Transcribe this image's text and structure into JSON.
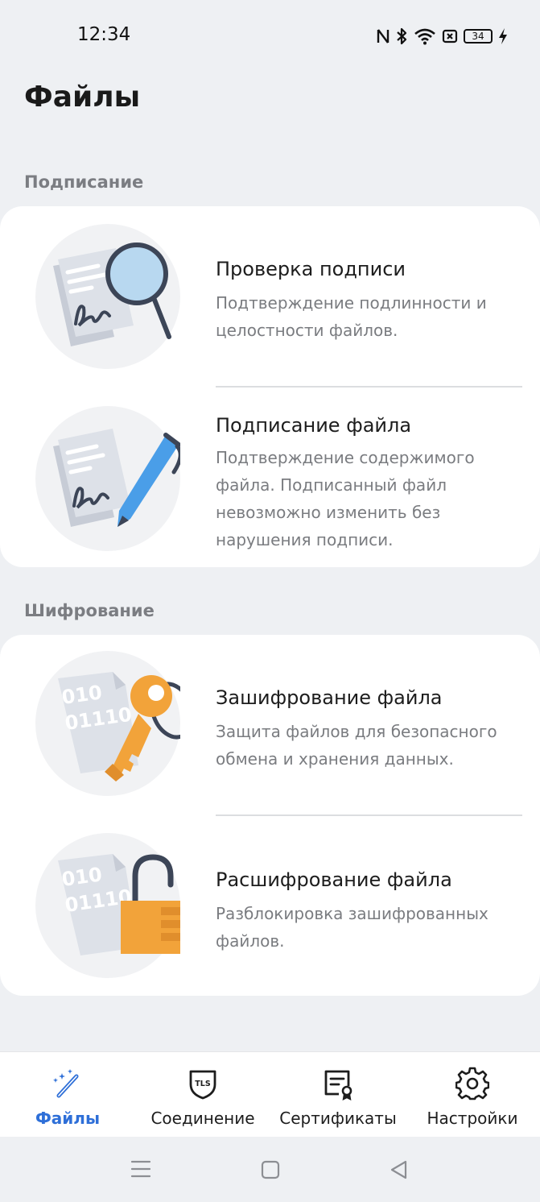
{
  "status": {
    "time": "12:34",
    "battery": "34"
  },
  "page": {
    "title": "Файлы"
  },
  "sections": {
    "signing": {
      "label": "Подписание",
      "items": [
        {
          "title": "Проверка подписи",
          "desc": "Подтверждение подлинности и целостности файлов."
        },
        {
          "title": "Подписание файла",
          "desc": "Подтверждение содержимого файла. Подписанный файл невозможно изменить без нарушения подписи."
        }
      ]
    },
    "encryption": {
      "label": "Шифрование",
      "items": [
        {
          "title": "Зашифрование файла",
          "desc": "Защита файлов для безопасного обмена и хранения данных."
        },
        {
          "title": "Расшифрование файла",
          "desc": "Разблокировка зашифрованных файлов."
        }
      ]
    }
  },
  "illustration_text": {
    "bits_top": "010",
    "bits_bottom": "01110"
  },
  "nav": {
    "items": [
      {
        "label": "Файлы",
        "icon": "magic-wand-icon",
        "active": true
      },
      {
        "label": "Соединение",
        "icon": "tls-shield-icon",
        "active": false
      },
      {
        "label": "Сертификаты",
        "icon": "certificate-icon",
        "active": false
      },
      {
        "label": "Настройки",
        "icon": "gear-icon",
        "active": false
      }
    ],
    "tls_badge": "TLS"
  },
  "colors": {
    "accent": "#2e6fd8",
    "background": "#eef0f3",
    "card": "#ffffff",
    "key": "#f2a33a",
    "pen": "#4a9ee8"
  }
}
